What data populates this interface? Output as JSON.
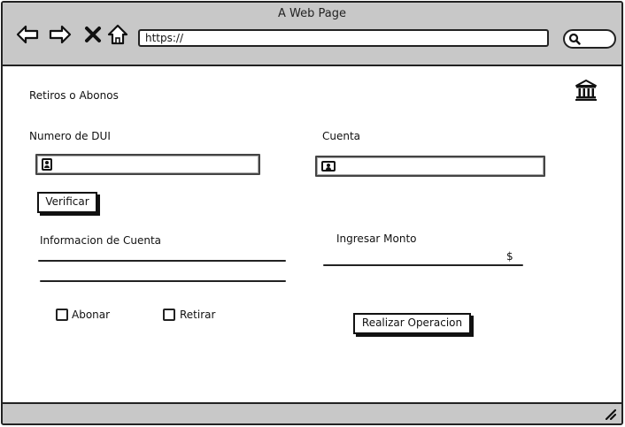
{
  "window": {
    "title": "A Web Page",
    "url": "https://"
  },
  "page": {
    "heading": "Retiros o  Abonos",
    "dui_label": "Numero de DUI",
    "cuenta_label": "Cuenta",
    "verify_button": "Verificar",
    "account_info_label": "Informacion de Cuenta",
    "amount_label": "Ingresar Monto",
    "currency_symbol": "$",
    "abonar_label": "Abonar",
    "retirar_label": "Retirar",
    "submit_button": "Realizar Operacion"
  },
  "icons": {
    "back": "back-arrow-icon",
    "forward": "forward-arrow-icon",
    "stop": "close-icon",
    "home": "home-icon",
    "search": "search-icon",
    "bank": "bank-icon",
    "id_card": "id-card-icon",
    "resize": "resize-grip-icon"
  }
}
